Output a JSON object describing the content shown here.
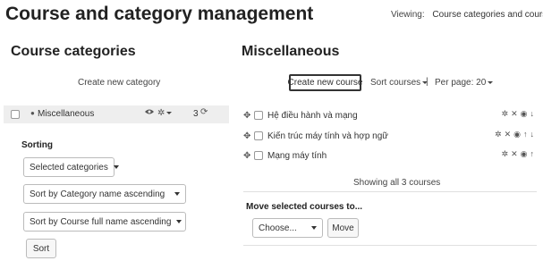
{
  "header": {
    "title": "Course and category management",
    "viewing_label": "Viewing:",
    "viewing_value": "Course categories and courses"
  },
  "categories_panel": {
    "heading": "Course categories",
    "create_link": "Create new category",
    "categories": [
      {
        "name": "Miscellaneous",
        "count": "3",
        "icons": {
          "visibility": "eye-icon",
          "settings": "gear-icon",
          "count": "courses-icon"
        }
      }
    ],
    "sorting": {
      "label": "Sorting",
      "selected_categories": "Selected categories",
      "sort_category": "Sort by Category name ascending",
      "sort_course": "Sort by Course full name ascending",
      "sort_button": "Sort"
    }
  },
  "courses_panel": {
    "heading": "Miscellaneous",
    "create_course": "Create new course",
    "sort_courses": "Sort courses",
    "separator": "|",
    "per_page": "Per page: 20",
    "courses": [
      {
        "name": "Hệ điều hành và mạng",
        "actions": [
          "gear-icon",
          "delete-icon",
          "eye-icon",
          "arrow-down-icon"
        ]
      },
      {
        "name": "Kiến trúc máy tính và hợp ngữ",
        "actions": [
          "gear-icon",
          "delete-icon",
          "eye-icon",
          "arrow-up-icon",
          "arrow-down-icon"
        ]
      },
      {
        "name": "Mạng máy tính",
        "actions": [
          "gear-icon",
          "delete-icon",
          "eye-icon",
          "arrow-up-icon"
        ]
      }
    ],
    "showing": "Showing all 3 courses",
    "move_label": "Move selected courses to...",
    "choose_value": "Choose...",
    "move_button": "Move"
  }
}
